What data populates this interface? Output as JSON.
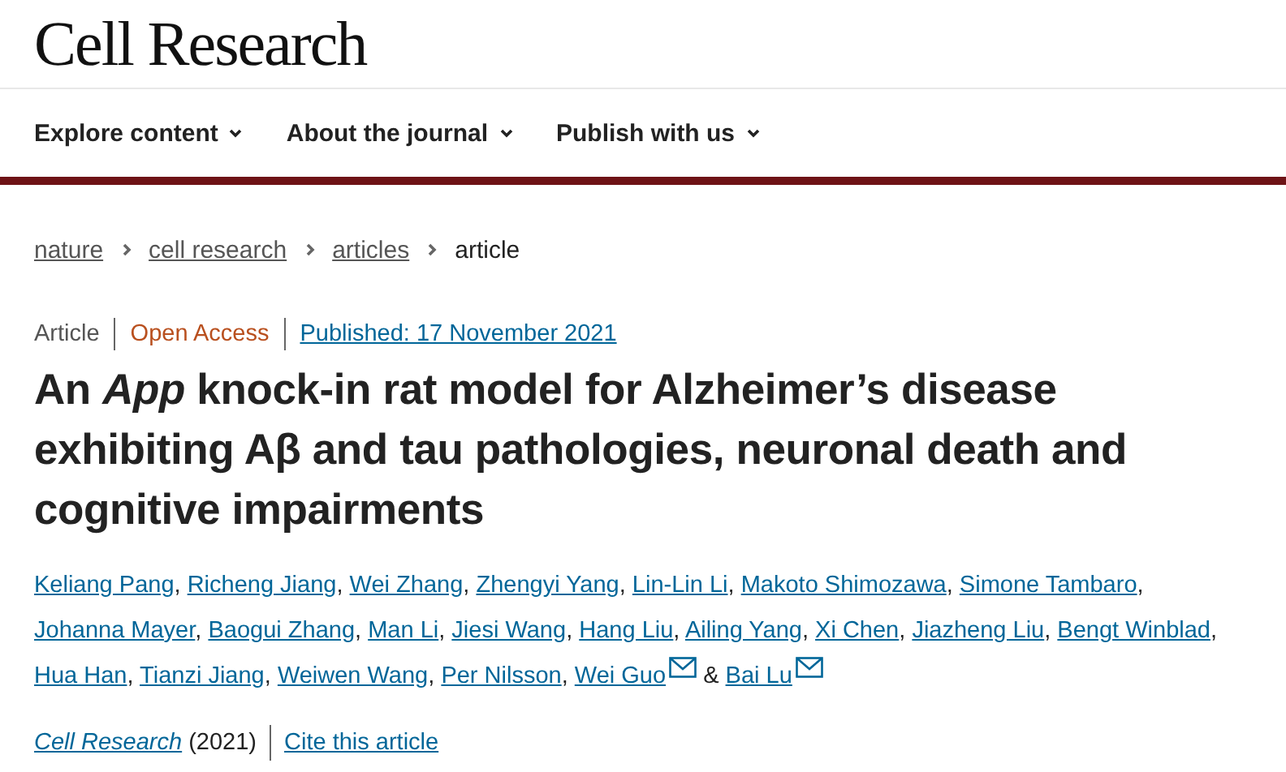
{
  "site": {
    "logo": "Cell Research"
  },
  "nav": [
    {
      "label": "Explore content"
    },
    {
      "label": "About the journal"
    },
    {
      "label": "Publish with us"
    }
  ],
  "breadcrumb": [
    {
      "label": "nature",
      "kind": "link"
    },
    {
      "label": "cell research",
      "kind": "link"
    },
    {
      "label": "articles",
      "kind": "link"
    },
    {
      "label": "article",
      "kind": "current"
    }
  ],
  "meta": {
    "type": "Article",
    "access": "Open Access",
    "published": "Published: 17 November 2021"
  },
  "title": "An *App* knock-in rat model for Alzheimer’s disease exhibiting Aβ and tau pathologies, neuronal death and cognitive impairments",
  "authors": [
    {
      "name": "Keliang Pang",
      "corresponding": false
    },
    {
      "name": "Richeng Jiang",
      "corresponding": false
    },
    {
      "name": "Wei Zhang",
      "corresponding": false
    },
    {
      "name": "Zhengyi Yang",
      "corresponding": false
    },
    {
      "name": "Lin-Lin Li",
      "corresponding": false
    },
    {
      "name": "Makoto Shimozawa",
      "corresponding": false
    },
    {
      "name": "Simone Tambaro",
      "corresponding": false
    },
    {
      "name": "Johanna Mayer",
      "corresponding": false
    },
    {
      "name": "Baogui Zhang",
      "corresponding": false
    },
    {
      "name": "Man Li",
      "corresponding": false
    },
    {
      "name": "Jiesi Wang",
      "corresponding": false
    },
    {
      "name": "Hang Liu",
      "corresponding": false
    },
    {
      "name": "Ailing Yang",
      "corresponding": false
    },
    {
      "name": "Xi Chen",
      "corresponding": false
    },
    {
      "name": "Jiazheng Liu",
      "corresponding": false
    },
    {
      "name": "Bengt Winblad",
      "corresponding": false
    },
    {
      "name": "Hua Han",
      "corresponding": false
    },
    {
      "name": "Tianzi Jiang",
      "corresponding": false
    },
    {
      "name": "Weiwen Wang",
      "corresponding": false
    },
    {
      "name": "Per Nilsson",
      "corresponding": false
    },
    {
      "name": "Wei Guo",
      "corresponding": true
    },
    {
      "name": "Bai Lu",
      "corresponding": true
    }
  ],
  "author_separator": ",",
  "author_last_joiner": "&",
  "citation": {
    "journal": "Cell Research",
    "year": "(2021)",
    "cite_link": "Cite this article"
  }
}
